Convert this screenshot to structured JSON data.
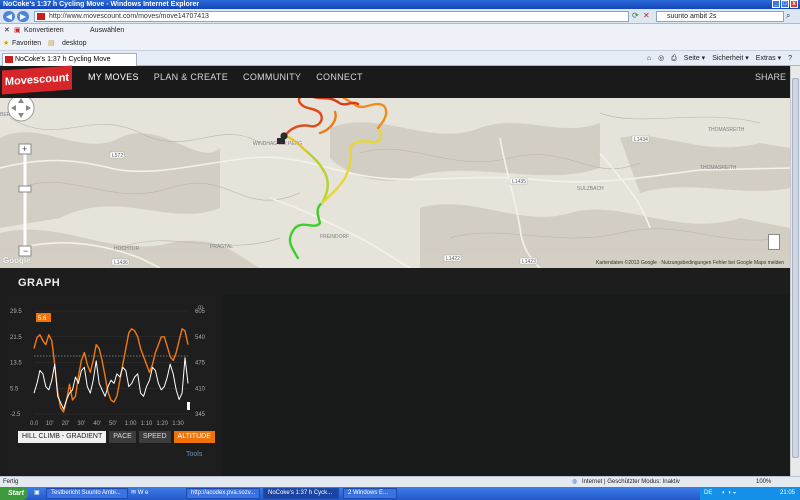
{
  "window": {
    "title": "NoCoke's 1:37 h Cycling Move - Windows Internet Explorer",
    "controls": [
      "_",
      "□",
      "x"
    ]
  },
  "address": {
    "url": "http://www.movescount.com/moves/move14707413",
    "search_value": "suunto ambit 2s"
  },
  "toolbar": {
    "konvertieren": "Konvertieren",
    "auswaehlen": "Auswählen"
  },
  "favorites": {
    "favoriten": "Favoriten",
    "desktop": "desktop"
  },
  "tab": {
    "label": "NoCoke's 1:37 h Cycling Move"
  },
  "command_bar": {
    "seite": "Seite ▾",
    "sicherheit": "Sicherheit ▾",
    "extras": "Extras ▾"
  },
  "site": {
    "logo": "Movescount",
    "nav": [
      "MY MOVES",
      "PLAN & CREATE",
      "COMMUNITY",
      "CONNECT"
    ],
    "share": "SHARE"
  },
  "map": {
    "labels": [
      "WINDHAG BEI PERG",
      "THOMASREITH",
      "THOMASREITH",
      "SULZBACH",
      "FREINDORF",
      "PRAGTAL",
      "HOCHTOR",
      "BERLEBING"
    ],
    "roads": [
      "L1434",
      "L1436",
      "L1422",
      "L1423",
      "L572",
      "L1435"
    ],
    "attribution": "Kartendaten ©2013 Google · Nutzungsbedingungen  Fehler bei Google Maps melden",
    "google": "Google"
  },
  "graph": {
    "header": "GRAPH",
    "current_value": "5.6",
    "left_unit": "",
    "right_unit": "m",
    "buttons": [
      "HILL CLIMB - GRADIENT",
      "PACE",
      "SPEED",
      "ALTITUDE"
    ],
    "tools": "Tools"
  },
  "chart_data": {
    "type": "line",
    "xlabel": "",
    "x_ticks": [
      "0.0",
      "10'",
      "20'",
      "30'",
      "40'",
      "50'",
      "1:00",
      "1:10",
      "1:20",
      "1:30"
    ],
    "left_ticks": [
      29.5,
      21.5,
      13.5,
      5.5,
      -2.5
    ],
    "right_ticks": [
      605,
      540,
      475,
      410,
      345
    ],
    "left_ylim": [
      -2.5,
      29.5
    ],
    "right_ylim": [
      345,
      605
    ],
    "colors": {
      "altitude": "#f07a12",
      "gradient": "#ffffff"
    },
    "series": [
      {
        "axis": "right",
        "values": [
          510,
          538,
          545,
          530,
          520,
          545,
          530,
          470,
          400,
          360,
          350,
          380,
          420,
          380,
          390,
          440,
          480,
          500,
          470,
          450,
          480,
          520,
          510,
          480,
          440,
          400,
          380,
          375,
          390,
          430,
          470,
          510,
          550,
          560,
          555,
          540,
          510,
          490,
          470,
          450,
          470,
          500,
          520,
          540,
          540,
          515,
          490,
          480,
          500,
          530,
          560,
          555,
          520
        ]
      },
      {
        "axis": "left",
        "values": [
          4,
          7,
          11,
          10,
          6,
          5,
          8,
          13,
          3,
          1,
          -1,
          2,
          4,
          5,
          9,
          7,
          11,
          12,
          6,
          4,
          8,
          14,
          7,
          5,
          3,
          6,
          8,
          7,
          10,
          9,
          12,
          11,
          6,
          7,
          9,
          10,
          4,
          3,
          6,
          8,
          12,
          11,
          7,
          5,
          6,
          9,
          13,
          10,
          5,
          2,
          4,
          15,
          7
        ]
      }
    ]
  },
  "statusbar": {
    "left": "Fertig",
    "zone": "Internet | Geschützter Modus: Inaktiv",
    "zoom": "100%"
  },
  "taskbar": {
    "start": "Start",
    "items": [
      "Testbericht Suunto Ambi...",
      "http://acodex.pva.sozv...",
      "NoCoke's 1:37 h Cyck...",
      "2 Windows E..."
    ],
    "lang": "DE",
    "clock": "21:05"
  }
}
